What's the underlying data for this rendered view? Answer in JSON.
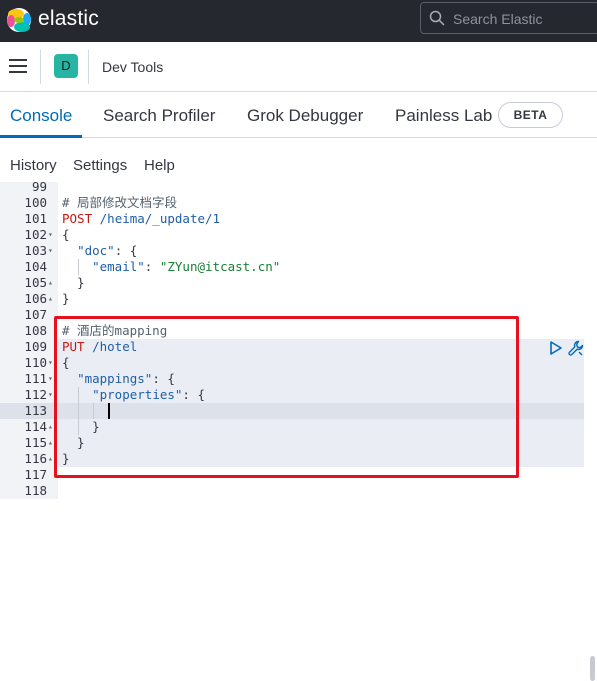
{
  "topbar": {
    "brand": "elastic",
    "search_placeholder": "Search Elastic",
    "icons": [
      "elastic-logo-icon",
      "search-icon"
    ]
  },
  "header": {
    "space_badge": "D",
    "breadcrumb": "Dev Tools",
    "icons": [
      "menu-icon"
    ]
  },
  "tabs": [
    {
      "label": "Console",
      "active": true
    },
    {
      "label": "Search Profiler",
      "active": false
    },
    {
      "label": "Grok Debugger",
      "active": false
    },
    {
      "label": "Painless Lab",
      "active": false
    }
  ],
  "beta_badge": "BETA",
  "subnav": [
    "History",
    "Settings",
    "Help"
  ],
  "editor": {
    "lines": [
      {
        "n": "99",
        "fold": "",
        "code": ""
      },
      {
        "n": "100",
        "fold": "",
        "code": "# 局部修改文档字段"
      },
      {
        "n": "101",
        "fold": "",
        "code": "POST /heima/_update/1"
      },
      {
        "n": "102",
        "fold": "▾",
        "code": "{"
      },
      {
        "n": "103",
        "fold": "▾",
        "code": "  \"doc\": {"
      },
      {
        "n": "104",
        "fold": "",
        "code": "    \"email\": \"ZYun@itcast.cn\""
      },
      {
        "n": "105",
        "fold": "▴",
        "code": "  }"
      },
      {
        "n": "106",
        "fold": "▴",
        "code": "}"
      },
      {
        "n": "107",
        "fold": "",
        "code": ""
      },
      {
        "n": "108",
        "fold": "",
        "code": "# 酒店的mapping"
      },
      {
        "n": "109",
        "fold": "",
        "code": "PUT /hotel"
      },
      {
        "n": "110",
        "fold": "▾",
        "code": "{"
      },
      {
        "n": "111",
        "fold": "▾",
        "code": "  \"mappings\": {"
      },
      {
        "n": "112",
        "fold": "▾",
        "code": "    \"properties\": {"
      },
      {
        "n": "113",
        "fold": "",
        "code": ""
      },
      {
        "n": "114",
        "fold": "▴",
        "code": "    }"
      },
      {
        "n": "115",
        "fold": "▴",
        "code": "  }"
      },
      {
        "n": "116",
        "fold": "▴",
        "code": "}"
      },
      {
        "n": "117",
        "fold": "",
        "code": ""
      },
      {
        "n": "118",
        "fold": "",
        "code": ""
      }
    ],
    "active_line": "113",
    "action_icons": [
      "run-request-icon",
      "wrench-icon"
    ]
  },
  "colors": {
    "topbar_bg": "#25282f",
    "accent": "#006bb8",
    "badge": "#26b5a3",
    "highlight_border": "#e6101e"
  }
}
